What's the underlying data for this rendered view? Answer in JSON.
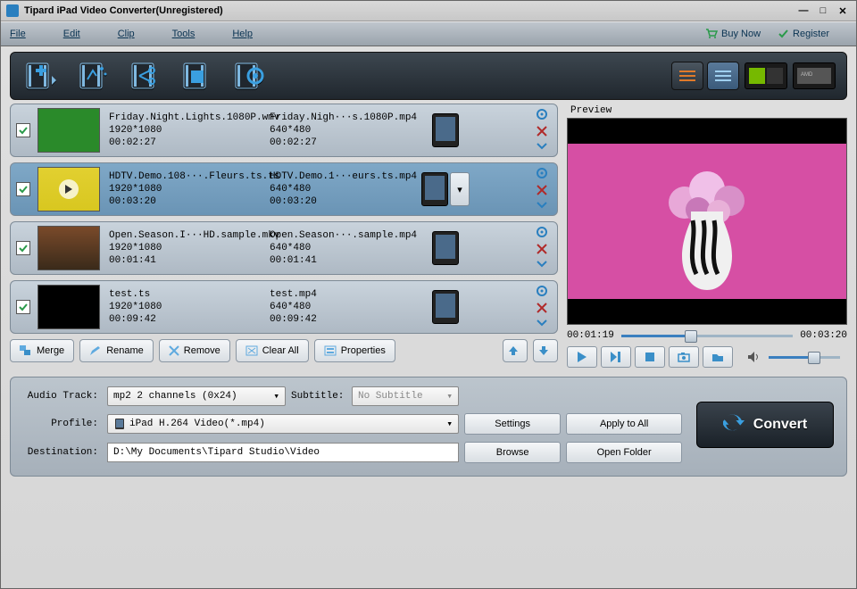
{
  "window": {
    "title": "Tipard iPad Video Converter(Unregistered)"
  },
  "menu": {
    "file": "File",
    "edit": "Edit",
    "clip": "Clip",
    "tools": "Tools",
    "help": "Help",
    "buy": "Buy Now",
    "register": "Register"
  },
  "list": {
    "items": [
      {
        "checked": true,
        "thumb": "green",
        "src_name": "Friday.Night.Lights.1080P.wmv",
        "src_res": "1920*1080",
        "src_dur": "00:02:27",
        "out_name": "Friday.Nigh···s.1080P.mp4",
        "out_res": "640*480",
        "out_dur": "00:02:27",
        "selected": false,
        "dropdown": false
      },
      {
        "checked": true,
        "thumb": "flower",
        "src_name": "HDTV.Demo.108···.Fleurs.ts.ts",
        "src_res": "1920*1080",
        "src_dur": "00:03:20",
        "out_name": "HDTV.Demo.1···eurs.ts.mp4",
        "out_res": "640*480",
        "out_dur": "00:03:20",
        "selected": true,
        "dropdown": true
      },
      {
        "checked": true,
        "thumb": "street",
        "src_name": "Open.Season.I···HD.sample.mkv",
        "src_res": "1920*1080",
        "src_dur": "00:01:41",
        "out_name": "Open.Season···.sample.mp4",
        "out_res": "640*480",
        "out_dur": "00:01:41",
        "selected": false,
        "dropdown": false
      },
      {
        "checked": true,
        "thumb": "dark",
        "src_name": "test.ts",
        "src_res": "1920*1080",
        "src_dur": "00:09:42",
        "out_name": "test.mp4",
        "out_res": "640*480",
        "out_dur": "00:09:42",
        "selected": false,
        "dropdown": false
      }
    ]
  },
  "footer": {
    "merge": "Merge",
    "rename": "Rename",
    "remove": "Remove",
    "clear": "Clear All",
    "properties": "Properties"
  },
  "preview": {
    "label": "Preview",
    "pos": "00:01:19",
    "dur": "00:03:20",
    "progress": 0.4
  },
  "settings": {
    "audio_label": "Audio Track:",
    "audio_value": "mp2 2 channels (0x24)",
    "subtitle_label": "Subtitle:",
    "subtitle_value": "No Subtitle",
    "profile_label": "Profile:",
    "profile_value": "iPad H.264 Video(*.mp4)",
    "dest_label": "Destination:",
    "dest_value": "D:\\My Documents\\Tipard Studio\\Video",
    "settings_btn": "Settings",
    "apply_btn": "Apply to All",
    "browse_btn": "Browse",
    "open_btn": "Open Folder",
    "convert_btn": "Convert"
  }
}
